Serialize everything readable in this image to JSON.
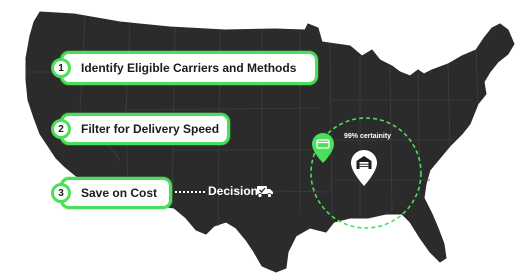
{
  "steps": [
    {
      "number": "1",
      "label": "Identify Eligible Carriers and Methods"
    },
    {
      "number": "2",
      "label": "Filter for Delivery Speed"
    },
    {
      "number": "3",
      "label": "Save on Cost"
    }
  ],
  "decision": {
    "label": "Decision",
    "icon": "truck-check-icon"
  },
  "certainty": {
    "label": "99% certainity"
  },
  "pins": {
    "carrier_pin_icon": "credit-card-icon",
    "warehouse_pin_icon": "warehouse-icon"
  },
  "colors": {
    "map_fill": "#2b2b2b",
    "state_lines": "#3e3e3e",
    "accent_green": "#4ade5a",
    "step_bg": "#ffffff",
    "text_dark": "#1c1c1c",
    "text_light": "#ffffff"
  }
}
